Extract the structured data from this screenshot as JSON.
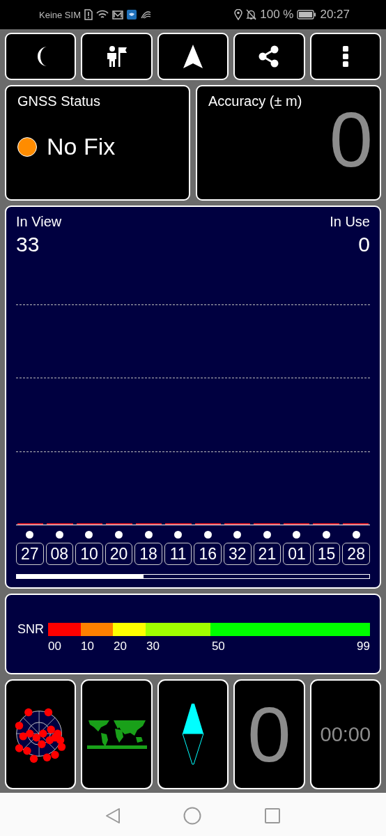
{
  "status_bar": {
    "carrier": "Keine SIM",
    "battery": "100 %",
    "time": "20:27"
  },
  "toolbar": [
    {
      "kind": "night"
    },
    {
      "kind": "waypoint"
    },
    {
      "kind": "navigate"
    },
    {
      "kind": "share"
    },
    {
      "kind": "menu"
    }
  ],
  "gnss_status": {
    "title": "GNSS Status",
    "status": "No Fix"
  },
  "accuracy": {
    "title": "Accuracy (± m)",
    "value": "0"
  },
  "satellites": {
    "in_view_label": "In View",
    "in_view": "33",
    "in_use_label": "In Use",
    "in_use": "0",
    "items": [
      {
        "prn": "27"
      },
      {
        "prn": "08"
      },
      {
        "prn": "10"
      },
      {
        "prn": "20"
      },
      {
        "prn": "18"
      },
      {
        "prn": "11"
      },
      {
        "prn": "16"
      },
      {
        "prn": "32"
      },
      {
        "prn": "21"
      },
      {
        "prn": "01"
      },
      {
        "prn": "15"
      },
      {
        "prn": "28"
      }
    ]
  },
  "snr_legend": {
    "label": "SNR",
    "segments": [
      {
        "color": "#ff0000"
      },
      {
        "color": "#ff8000"
      },
      {
        "color": "#ffff00"
      },
      {
        "color": "#a0ff00"
      },
      {
        "color": "#00ff00"
      }
    ],
    "ticks": [
      "00",
      "10",
      "20",
      "30",
      "50",
      "99"
    ]
  },
  "tiles": [
    {
      "kind": "skyplot"
    },
    {
      "kind": "world_map"
    },
    {
      "kind": "compass"
    },
    {
      "kind": "counter",
      "value": "0"
    },
    {
      "kind": "timer",
      "value": "00:00"
    }
  ]
}
